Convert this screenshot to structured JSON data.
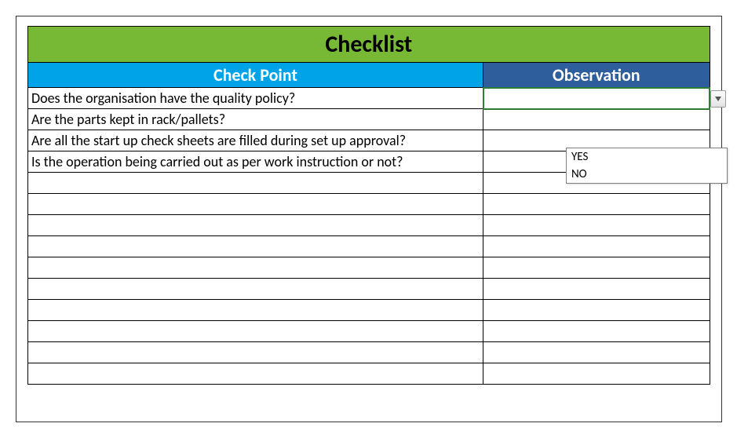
{
  "title": "Checklist",
  "headers": {
    "checkpoint": "Check Point",
    "observation": "Observation"
  },
  "rows": [
    {
      "checkpoint": "Does the organisation have the quality policy?",
      "observation": ""
    },
    {
      "checkpoint": "Are the parts kept in rack/pallets?",
      "observation": ""
    },
    {
      "checkpoint": "Are all the start up check sheets are filled during set up approval?",
      "observation": ""
    },
    {
      "checkpoint": "Is the operation being carried out as per work instruction or not?",
      "observation": ""
    },
    {
      "checkpoint": "",
      "observation": ""
    },
    {
      "checkpoint": "",
      "observation": ""
    },
    {
      "checkpoint": "",
      "observation": ""
    },
    {
      "checkpoint": "",
      "observation": ""
    },
    {
      "checkpoint": "",
      "observation": ""
    },
    {
      "checkpoint": "",
      "observation": ""
    },
    {
      "checkpoint": "",
      "observation": ""
    },
    {
      "checkpoint": "",
      "observation": ""
    },
    {
      "checkpoint": "",
      "observation": ""
    },
    {
      "checkpoint": "",
      "observation": ""
    }
  ],
  "dropdown": {
    "options": [
      "YES",
      "NO"
    ]
  },
  "activeRowIndex": 0
}
